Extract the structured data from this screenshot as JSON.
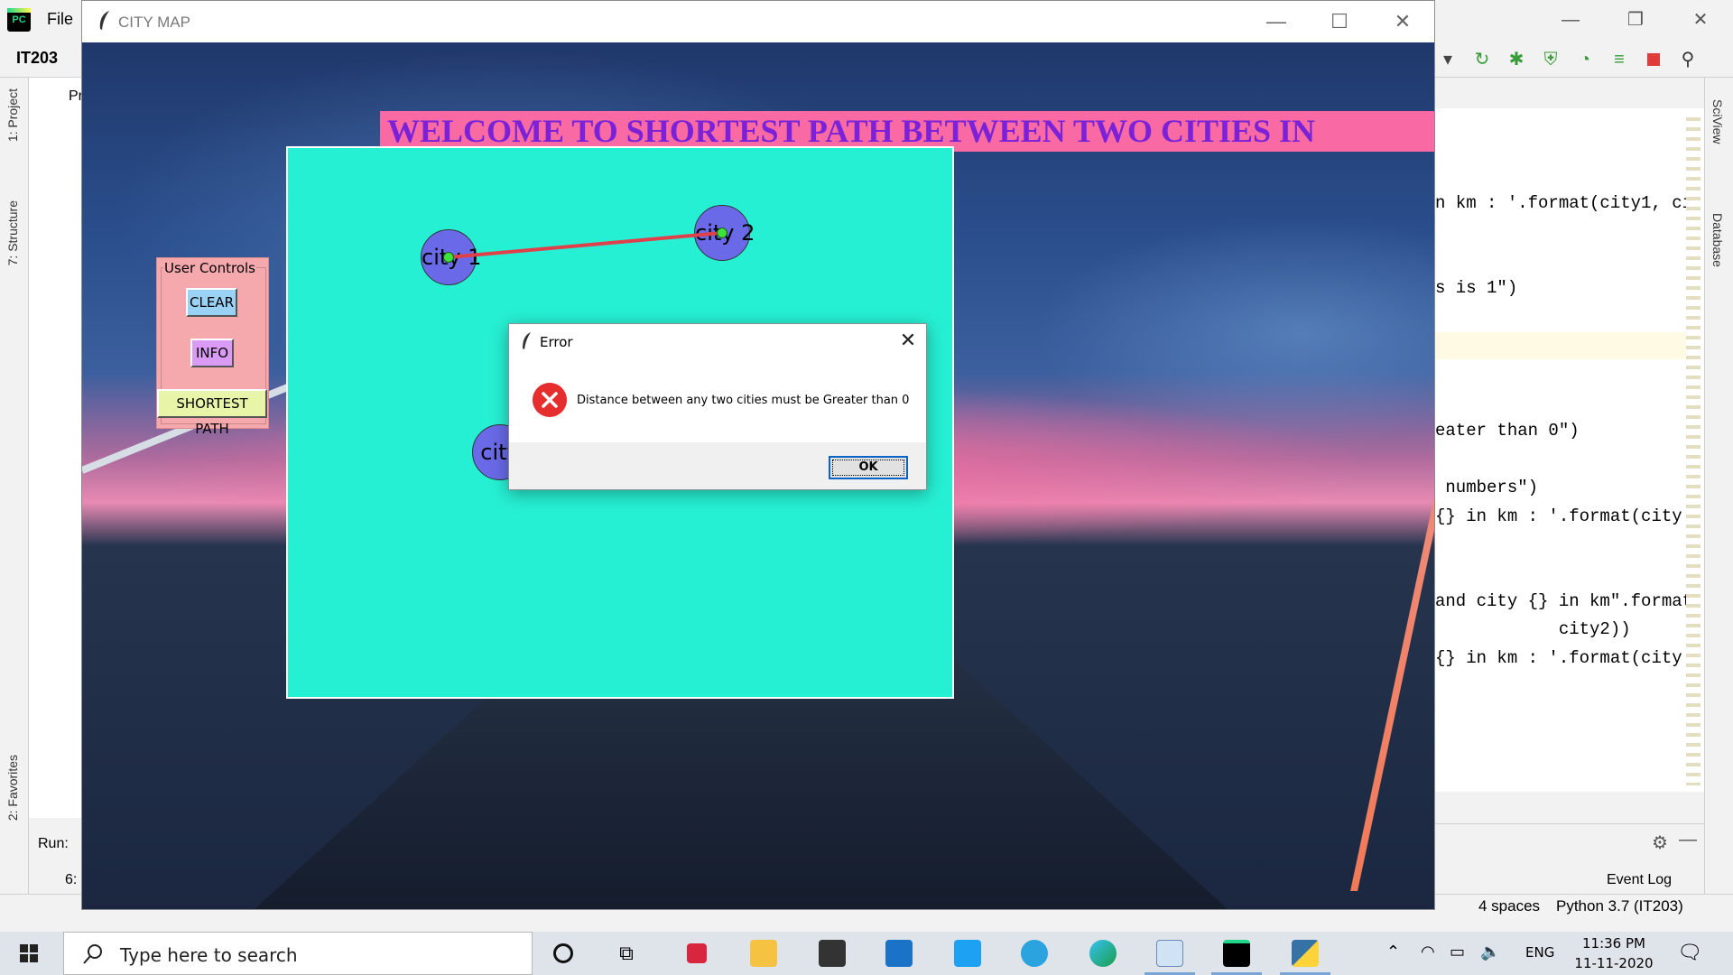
{
  "ide": {
    "file_menu": "File",
    "project_name": "IT203",
    "project_tab_partial": "Pr",
    "left_tabs": [
      "1: Project",
      "7: Structure",
      "2: Favorites"
    ],
    "right_tabs": [
      "SciView",
      "Database"
    ],
    "run_label": "Run:",
    "run_config_partial": "6:",
    "event_log": "Event Log",
    "status_indent": "4 spaces",
    "status_interpreter": "Python 3.7 (IT203)",
    "code_lines": [
      {
        "text": "n km : '.format(city1, ci"
      },
      {
        "text": "s is 1\")"
      },
      {
        "text": "eater than 0\")"
      },
      {
        "text": " numbers\")"
      },
      {
        "text": "{} in km : '.format(city"
      },
      {
        "text": "and city {} in km\".format"
      },
      {
        "text": "            city2))"
      },
      {
        "text": "{} in km : '.format(city"
      }
    ]
  },
  "tk_window": {
    "title": "CITY MAP",
    "banner": "WELCOME TO SHORTEST PATH BETWEEN TWO CITIES IN",
    "user_controls": {
      "label": "User Controls",
      "clear_button": "CLEAR",
      "info_button": "INFO",
      "shortest_path_button": "SHORTEST PATH"
    },
    "cities": [
      {
        "label": "city 1"
      },
      {
        "label": "city 2"
      },
      {
        "label": "city"
      }
    ],
    "edge_color": "#e0404a",
    "map_color": "#26f0d3"
  },
  "error_dialog": {
    "title": "Error",
    "message": "Distance between any two cities must be Greater than 0",
    "ok_button": "OK"
  },
  "taskbar": {
    "search_placeholder": "Type here to search",
    "language": "ENG",
    "time": "11:36 PM",
    "date": "11-11-2020",
    "apps": [
      "cortana-icon",
      "task-view-icon",
      "gift-icon",
      "file-explorer-icon",
      "store-icon",
      "mail-icon",
      "twitter-icon",
      "telegram-icon",
      "edge-icon",
      "notepad-icon",
      "pycharm-icon",
      "python-icon"
    ]
  }
}
